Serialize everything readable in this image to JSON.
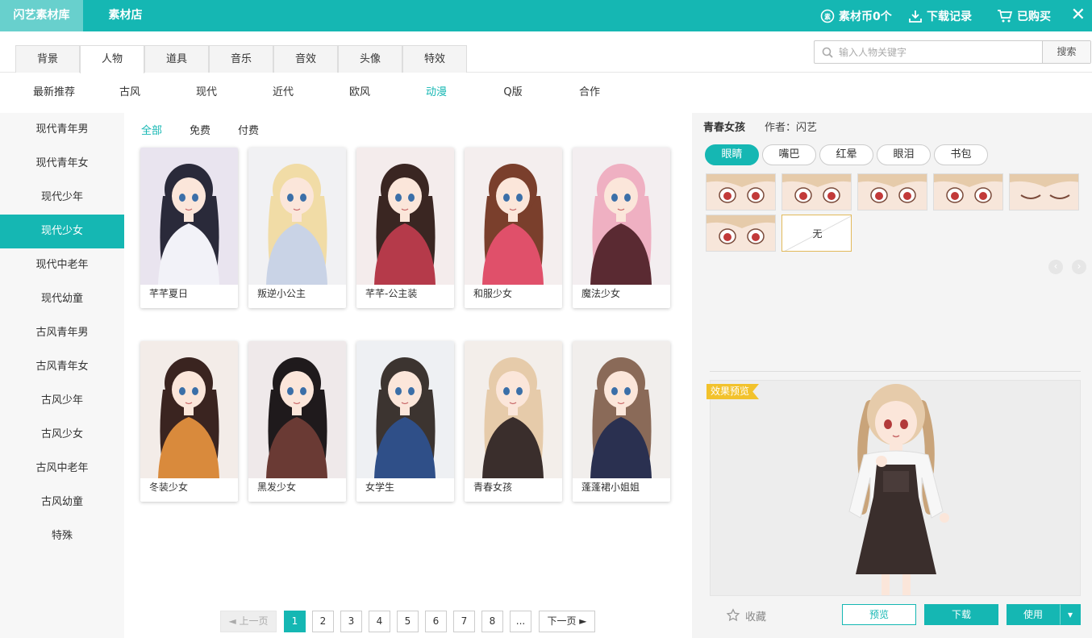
{
  "topbar": {
    "brand": "闪艺素材库",
    "shop": "素材店",
    "coins": "素材币0个",
    "downloads": "下载记录",
    "purchased": "已购买",
    "close": "✕"
  },
  "tabs": [
    {
      "label": "背景"
    },
    {
      "label": "人物"
    },
    {
      "label": "道具"
    },
    {
      "label": "音乐"
    },
    {
      "label": "音效"
    },
    {
      "label": "头像"
    },
    {
      "label": "特效"
    }
  ],
  "search": {
    "placeholder": "输入人物关键字",
    "button": "搜索"
  },
  "subnav": [
    {
      "label": "最新推荐"
    },
    {
      "label": "古风"
    },
    {
      "label": "现代"
    },
    {
      "label": "近代"
    },
    {
      "label": "欧风"
    },
    {
      "label": "动漫"
    },
    {
      "label": "Q版"
    },
    {
      "label": "合作"
    }
  ],
  "sidebar": [
    {
      "label": "现代青年男"
    },
    {
      "label": "现代青年女"
    },
    {
      "label": "现代少年"
    },
    {
      "label": "现代少女"
    },
    {
      "label": "现代中老年"
    },
    {
      "label": "现代幼童"
    },
    {
      "label": "古风青年男"
    },
    {
      "label": "古风青年女"
    },
    {
      "label": "古风少年"
    },
    {
      "label": "古风少女"
    },
    {
      "label": "古风中老年"
    },
    {
      "label": "古风幼童"
    },
    {
      "label": "特殊"
    }
  ],
  "filters": [
    {
      "label": "全部"
    },
    {
      "label": "免费"
    },
    {
      "label": "付费"
    }
  ],
  "cards": [
    {
      "label": "芊芊夏日",
      "hair": "#2a2a3a",
      "outfit": "#f2f2f8",
      "bg": "#e9e4ef"
    },
    {
      "label": "叛逆小公主",
      "hair": "#f1dca6",
      "outfit": "#c9d3e6",
      "bg": "#f1f1f3"
    },
    {
      "label": "芊芊-公主装",
      "hair": "#3a2622",
      "outfit": "#b53a4a",
      "bg": "#f4ecec"
    },
    {
      "label": "和服少女",
      "hair": "#7a3f2c",
      "outfit": "#e0506a",
      "bg": "#f4eeee"
    },
    {
      "label": "魔法少女",
      "hair": "#efb0c2",
      "outfit": "#5a2a32",
      "bg": "#f3eef0"
    },
    {
      "label": "冬装少女",
      "hair": "#3a2420",
      "outfit": "#d98a3c",
      "bg": "#f3ece8"
    },
    {
      "label": "黑发少女",
      "hair": "#1f1a1c",
      "outfit": "#6a3a34",
      "bg": "#efe9ea"
    },
    {
      "label": "女学生",
      "hair": "#3c3430",
      "outfit": "#2f4f88",
      "bg": "#eef0f3"
    },
    {
      "label": "青春女孩",
      "hair": "#e6cbaa",
      "outfit": "#3a2e2c",
      "bg": "#f3eeea"
    },
    {
      "label": "蓬蓬裙小姐姐",
      "hair": "#8a6a58",
      "outfit": "#2a3050",
      "bg": "#f1eeec"
    }
  ],
  "pager": {
    "prev": "◄ 上一页",
    "pages": [
      "1",
      "2",
      "3",
      "4",
      "5",
      "6",
      "7",
      "8",
      "..."
    ],
    "next": "下一页 ►"
  },
  "panel": {
    "title": "青春女孩",
    "author": "作者：闪艺",
    "tabs": [
      {
        "label": "眼睛"
      },
      {
        "label": "嘴巴"
      },
      {
        "label": "红晕"
      },
      {
        "label": "眼泪"
      },
      {
        "label": "书包"
      }
    ],
    "none_label": "无",
    "prev_icon": "‹",
    "next_icon": "›",
    "preview_badge": "效果预览",
    "favorite": "收藏",
    "btn_preview": "预览",
    "btn_download": "下载",
    "btn_use": "使用",
    "btn_use_arrow": "▾"
  },
  "colors": {
    "accent": "#15b7b3",
    "brand_tab": "#68d0cd",
    "badge": "#f2c22c"
  }
}
